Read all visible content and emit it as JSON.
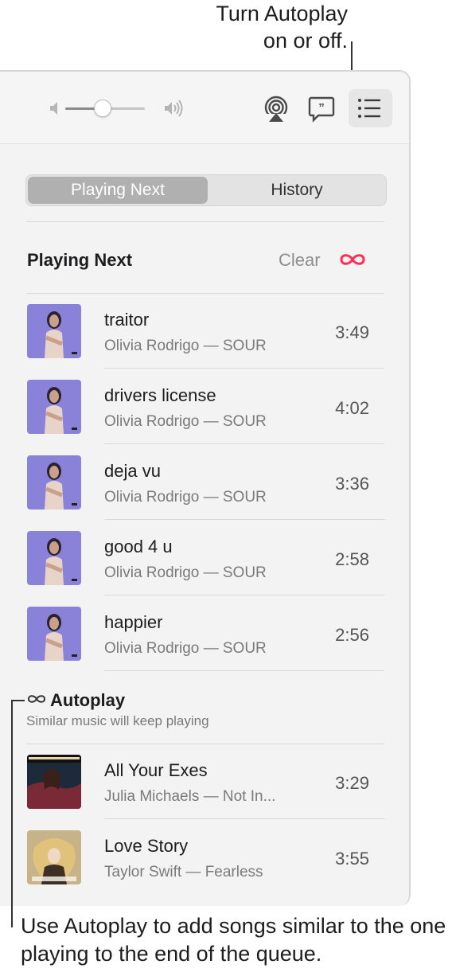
{
  "callouts": {
    "top_line1": "Turn Autoplay",
    "top_line2": "on or off.",
    "bottom": "Use Autoplay to add songs similar to the one playing to the end of the queue."
  },
  "toolbar": {
    "volume_level": 0.45,
    "airplay_icon": "airplay-icon",
    "lyrics_icon": "lyrics-icon",
    "queue_icon": "list-icon"
  },
  "tabs": {
    "playing_next": "Playing Next",
    "history": "History",
    "selected": "Playing Next"
  },
  "playing_next": {
    "title": "Playing Next",
    "clear_label": "Clear",
    "autoplay_color": "#ff2d55",
    "items": [
      {
        "title": "traitor",
        "subtitle": "Olivia Rodrigo — SOUR",
        "duration": "3:49"
      },
      {
        "title": "drivers license",
        "subtitle": "Olivia Rodrigo — SOUR",
        "duration": "4:02"
      },
      {
        "title": "deja vu",
        "subtitle": "Olivia Rodrigo — SOUR",
        "duration": "3:36"
      },
      {
        "title": "good 4 u",
        "subtitle": "Olivia Rodrigo — SOUR",
        "duration": "2:58"
      },
      {
        "title": "happier",
        "subtitle": "Olivia Rodrigo — SOUR",
        "duration": "2:56"
      }
    ]
  },
  "autoplay": {
    "title": "Autoplay",
    "subtitle": "Similar music will keep playing",
    "items": [
      {
        "title": "All Your Exes",
        "subtitle": "Julia Michaels — Not In...",
        "duration": "3:29"
      },
      {
        "title": "Love Story",
        "subtitle": "Taylor Swift — Fearless",
        "duration": "3:55"
      }
    ]
  }
}
